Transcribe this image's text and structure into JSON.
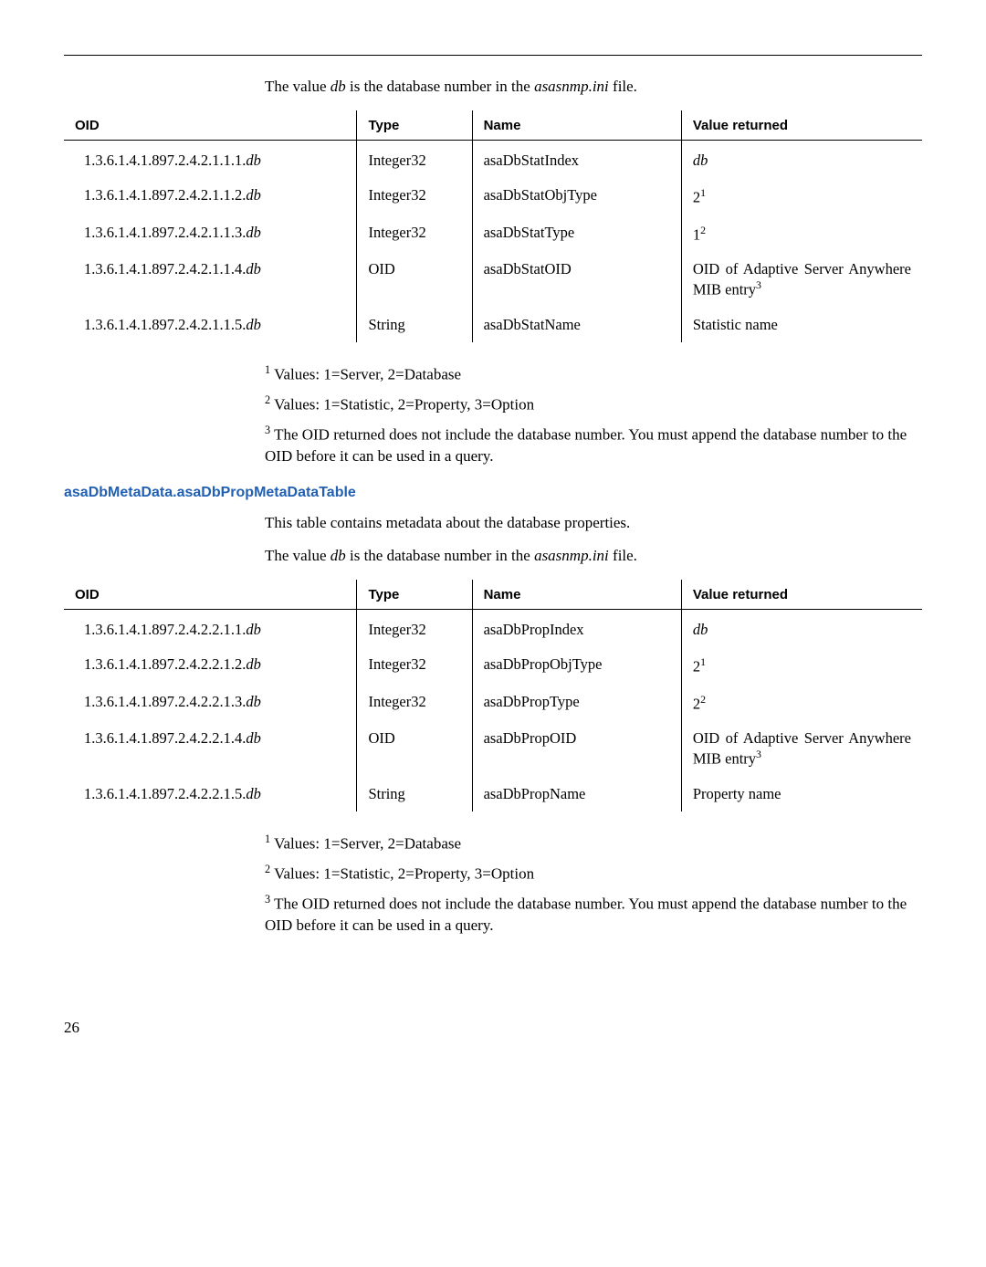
{
  "intro1_prefix": "The value ",
  "intro1_db": "db",
  "intro1_mid": " is the database number in the ",
  "intro1_file": "asasnmp.ini",
  "intro1_suffix": " file.",
  "table1": {
    "headers": {
      "oid": "OID",
      "type": "Type",
      "name": "Name",
      "value": "Value returned"
    },
    "rows": [
      {
        "oid_prefix": "1.3.6.1.4.1.897.2.4.2.1.1.1.",
        "oid_db": "db",
        "type": "Integer32",
        "name": "asaDbStatIndex",
        "val_pre": "",
        "val_ital": "db",
        "val_sup": ""
      },
      {
        "oid_prefix": "1.3.6.1.4.1.897.2.4.2.1.1.2.",
        "oid_db": "db",
        "type": "Integer32",
        "name": "asaDbStatObjType",
        "val_pre": "2",
        "val_ital": "",
        "val_sup": "1"
      },
      {
        "oid_prefix": "1.3.6.1.4.1.897.2.4.2.1.1.3.",
        "oid_db": "db",
        "type": "Integer32",
        "name": "asaDbStatType",
        "val_pre": "1",
        "val_ital": "",
        "val_sup": "2"
      },
      {
        "oid_prefix": "1.3.6.1.4.1.897.2.4.2.1.1.4.",
        "oid_db": "db",
        "type": "OID",
        "name": "asaDbStatOID",
        "val_pre": "OID of Adaptive Server Anywhere MIB entry",
        "val_ital": "",
        "val_sup": "3"
      },
      {
        "oid_prefix": "1.3.6.1.4.1.897.2.4.2.1.1.5.",
        "oid_db": "db",
        "type": "String",
        "name": "asaDbStatName",
        "val_pre": "Statistic name",
        "val_ital": "",
        "val_sup": ""
      }
    ]
  },
  "footnotes1": {
    "f1_sup": "1",
    "f1_text": " Values: 1=Server, 2=Database",
    "f2_sup": "2",
    "f2_text": " Values: 1=Statistic, 2=Property, 3=Option",
    "f3_sup": "3",
    "f3_text": " The OID returned does not include the database number. You must append the database number to the OID before it can be used in a query."
  },
  "section_head": "asaDbMetaData.asaDbPropMetaDataTable",
  "intro2_text": "This table contains metadata about the database properties.",
  "table2": {
    "headers": {
      "oid": "OID",
      "type": "Type",
      "name": "Name",
      "value": "Value returned"
    },
    "rows": [
      {
        "oid_prefix": "1.3.6.1.4.1.897.2.4.2.2.1.1.",
        "oid_db": "db",
        "type": "Integer32",
        "name": "asaDbPropIndex",
        "val_pre": "",
        "val_ital": "db",
        "val_sup": ""
      },
      {
        "oid_prefix": "1.3.6.1.4.1.897.2.4.2.2.1.2.",
        "oid_db": "db",
        "type": "Integer32",
        "name": "asaDbPropObjType",
        "val_pre": "2",
        "val_ital": "",
        "val_sup": "1"
      },
      {
        "oid_prefix": "1.3.6.1.4.1.897.2.4.2.2.1.3.",
        "oid_db": "db",
        "type": "Integer32",
        "name": "asaDbPropType",
        "val_pre": "2",
        "val_ital": "",
        "val_sup": "2"
      },
      {
        "oid_prefix": "1.3.6.1.4.1.897.2.4.2.2.1.4.",
        "oid_db": "db",
        "type": "OID",
        "name": "asaDbPropOID",
        "val_pre": "OID of Adaptive Server Anywhere MIB entry",
        "val_ital": "",
        "val_sup": "3"
      },
      {
        "oid_prefix": "1.3.6.1.4.1.897.2.4.2.2.1.5.",
        "oid_db": "db",
        "type": "String",
        "name": "asaDbPropName",
        "val_pre": "Property name",
        "val_ital": "",
        "val_sup": ""
      }
    ]
  },
  "page_number": "26"
}
